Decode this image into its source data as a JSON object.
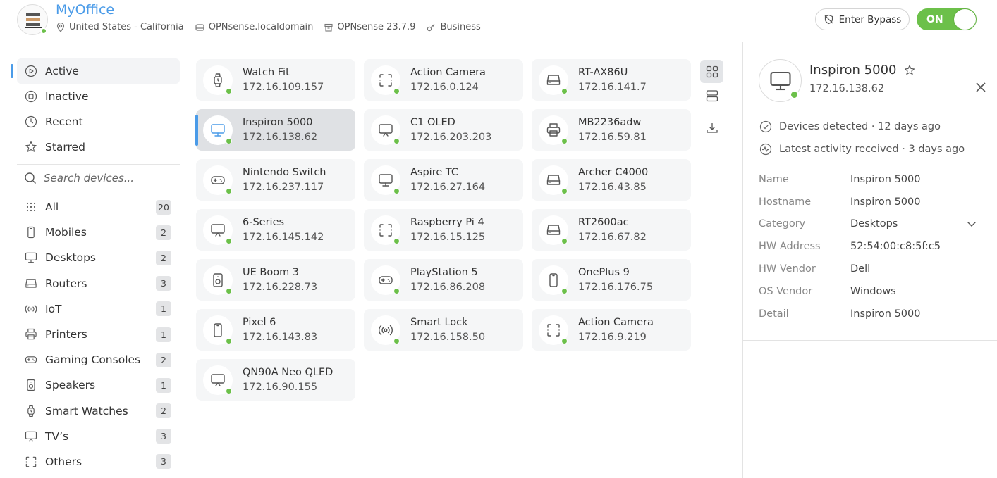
{
  "header": {
    "site_name": "MyOffice",
    "meta": {
      "location": "United States - California",
      "host": "OPNsense.localdomain",
      "version": "OPNsense 23.7.9",
      "plan": "Business"
    },
    "bypass_label": "Enter Bypass",
    "toggle_label": "ON"
  },
  "sidebar": {
    "status": [
      {
        "label": "Active",
        "icon": "play-circle-icon"
      },
      {
        "label": "Inactive",
        "icon": "stop-circle-icon"
      },
      {
        "label": "Recent",
        "icon": "clock-icon"
      },
      {
        "label": "Starred",
        "icon": "star-icon"
      }
    ],
    "search_placeholder": "Search devices...",
    "categories": [
      {
        "label": "All",
        "count": "20",
        "icon": "grid-dots-icon"
      },
      {
        "label": "Mobiles",
        "count": "2",
        "icon": "mobile-icon"
      },
      {
        "label": "Desktops",
        "count": "2",
        "icon": "desktop-icon"
      },
      {
        "label": "Routers",
        "count": "3",
        "icon": "router-icon"
      },
      {
        "label": "IoT",
        "count": "1",
        "icon": "iot-icon"
      },
      {
        "label": "Printers",
        "count": "1",
        "icon": "printer-icon"
      },
      {
        "label": "Gaming Consoles",
        "count": "2",
        "icon": "gamepad-icon"
      },
      {
        "label": "Speakers",
        "count": "1",
        "icon": "speaker-icon"
      },
      {
        "label": "Smart Watches",
        "count": "2",
        "icon": "watch-icon"
      },
      {
        "label": "TV’s",
        "count": "3",
        "icon": "tv-icon"
      },
      {
        "label": "Others",
        "count": "3",
        "icon": "others-icon"
      }
    ]
  },
  "devices": [
    {
      "name": "Watch Fit",
      "ip": "172.16.109.157",
      "icon": "watch"
    },
    {
      "name": "Action Camera",
      "ip": "172.16.0.124",
      "icon": "others"
    },
    {
      "name": "RT-AX86U",
      "ip": "172.16.141.7",
      "icon": "router"
    },
    {
      "name": "Inspiron 5000",
      "ip": "172.16.138.62",
      "icon": "desktop"
    },
    {
      "name": "C1 OLED",
      "ip": "172.16.203.203",
      "icon": "tv"
    },
    {
      "name": "MB2236adw",
      "ip": "172.16.59.81",
      "icon": "printer"
    },
    {
      "name": "Nintendo Switch",
      "ip": "172.16.237.117",
      "icon": "gamepad"
    },
    {
      "name": "Aspire TC",
      "ip": "172.16.27.164",
      "icon": "desktop"
    },
    {
      "name": "Archer C4000",
      "ip": "172.16.43.85",
      "icon": "router"
    },
    {
      "name": "6-Series",
      "ip": "172.16.145.142",
      "icon": "tv"
    },
    {
      "name": "Raspberry Pi 4",
      "ip": "172.16.15.125",
      "icon": "others"
    },
    {
      "name": "RT2600ac",
      "ip": "172.16.67.82",
      "icon": "router"
    },
    {
      "name": "UE Boom 3",
      "ip": "172.16.228.73",
      "icon": "speaker"
    },
    {
      "name": "PlayStation 5",
      "ip": "172.16.86.208",
      "icon": "gamepad"
    },
    {
      "name": "OnePlus 9",
      "ip": "172.16.176.75",
      "icon": "mobile"
    },
    {
      "name": "Pixel 6",
      "ip": "172.16.143.83",
      "icon": "mobile"
    },
    {
      "name": "Smart Lock",
      "ip": "172.16.158.50",
      "icon": "iot"
    },
    {
      "name": "Action Camera",
      "ip": "172.16.9.219",
      "icon": "others"
    },
    {
      "name": "QN90A Neo QLED",
      "ip": "172.16.90.155",
      "icon": "tv"
    }
  ],
  "view_tools": {
    "icons": [
      "grid-view-icon",
      "list-view-icon",
      "download-icon"
    ]
  },
  "panel": {
    "name": "Inspiron 5000",
    "ip": "172.16.138.62",
    "events": [
      "Devices detected · 12 days ago",
      "Latest activity received · 3 days ago"
    ],
    "props": [
      {
        "key": "Name",
        "value": "Inspiron 5000"
      },
      {
        "key": "Hostname",
        "value": "Inspiron 5000"
      },
      {
        "key": "Category",
        "value": "Desktops"
      },
      {
        "key": "HW Address",
        "value": "52:54:00:c8:5f:c5"
      },
      {
        "key": "HW Vendor",
        "value": "Dell"
      },
      {
        "key": "OS Vendor",
        "value": "Windows"
      },
      {
        "key": "Detail",
        "value": "Inspiron 5000"
      }
    ]
  },
  "colors": {
    "accent": "#4a9be8",
    "online": "#6cc04a",
    "toggle_on": "#6cc04a"
  }
}
